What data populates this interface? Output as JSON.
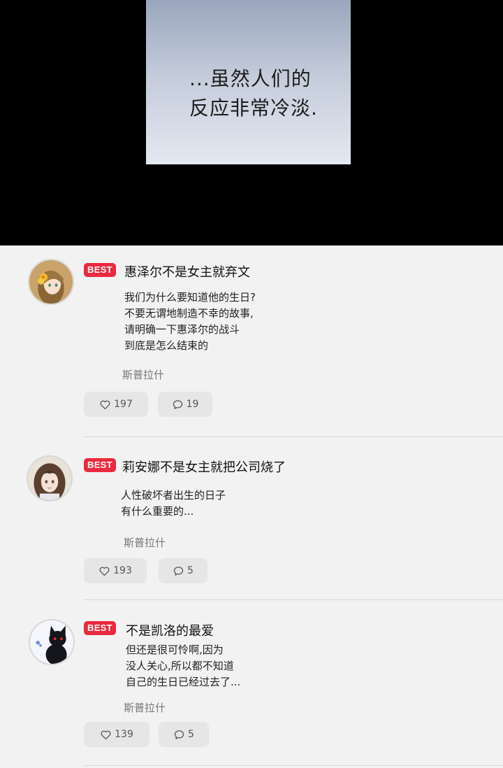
{
  "comic": {
    "line1": "...虽然人们的",
    "line2": "反应非常冷淡."
  },
  "comments": [
    {
      "badge": "BEST",
      "username": "惠泽尔不是女主就弃文",
      "lines": [
        "我们为什么要知道他的生日?",
        "不要无谓地制造不幸的故事,",
        "请明确一下惠泽尔的战斗",
        "到底是怎么结束的"
      ],
      "episode": "斯普拉什",
      "likes": "197",
      "replies": "19",
      "avatar_icon": "girl-with-flower-avatar"
    },
    {
      "badge": "BEST",
      "username": "莉安娜不是女主就把公司烧了",
      "lines": [
        "人性破坏者出生的日子",
        "有什么重要的..."
      ],
      "episode": "斯普拉什",
      "likes": "193",
      "replies": "5",
      "avatar_icon": "brown-haired-girl-avatar"
    },
    {
      "badge": "BEST",
      "username": "不是凯洛的最爱",
      "lines": [
        "但还是很可怜啊,因为",
        "没人关心,所以都不知道",
        "自己的生日已经过去了..."
      ],
      "episode": "斯普拉什",
      "likes": "139",
      "replies": "5",
      "avatar_icon": "black-cat-avatar"
    }
  ],
  "colors": {
    "badge_red": "#ea2a3e",
    "page_bg": "#f2f2f2",
    "pill_bg": "#e6e6e6"
  }
}
